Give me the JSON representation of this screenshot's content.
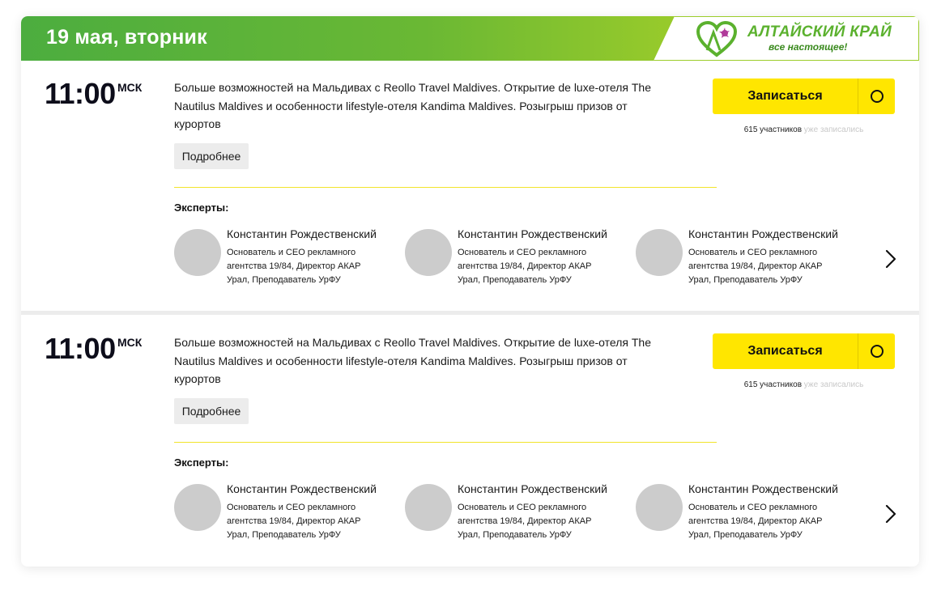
{
  "header": {
    "date_title": "19 мая, вторник",
    "logo": {
      "line1": "АЛТАЙСКИЙ КРАЙ",
      "line2": "все настоящее!",
      "icon": "altai-heart-logo-icon"
    }
  },
  "colors": {
    "header_green": "#4cad3f",
    "header_lime": "#b6d424",
    "signup_yellow": "#ffe600",
    "divider_yellow": "#f2e42a",
    "avatar_gray": "#cccccc"
  },
  "sessions": [
    {
      "time": "11:00",
      "tz": "МСК",
      "description": "Больше возможностей на Мальдивах с Reollo Travel Maldives. Открытие de luxe-отеля The Nautilus Maldives и особенности lifestyle-отеля Kandima Maldives. Розыгрыш призов от курортов",
      "more_label": "Подробнее",
      "signup_label": "Записаться",
      "participants_count": "615 участников",
      "participants_suffix": "уже записались",
      "experts_title": "Эксперты:",
      "experts": [
        {
          "name": "Константин Рождественский",
          "role": "Основатель и CEO рекламного агентства 19/84, Директор АКАР Урал, Преподаватель УрФУ"
        },
        {
          "name": "Константин Рождественский",
          "role": "Основатель и CEO рекламного агентства 19/84, Директор АКАР Урал, Преподаватель УрФУ"
        },
        {
          "name": "Константин Рождественский",
          "role": "Основатель и CEO рекламного агентства 19/84, Директор АКАР Урал, Преподаватель УрФУ"
        }
      ]
    },
    {
      "time": "11:00",
      "tz": "МСК",
      "description": "Больше возможностей на Мальдивах с Reollo Travel Maldives. Открытие de luxe-отеля The Nautilus Maldives и особенности lifestyle-отеля Kandima Maldives. Розыгрыш призов от курортов",
      "more_label": "Подробнее",
      "signup_label": "Записаться",
      "participants_count": "615 участников",
      "participants_suffix": "уже записались",
      "experts_title": "Эксперты:",
      "experts": [
        {
          "name": "Константин Рождественский",
          "role": "Основатель и CEO рекламного агентства 19/84, Директор АКАР Урал, Преподаватель УрФУ"
        },
        {
          "name": "Константин Рождественский",
          "role": "Основатель и CEO рекламного агентства 19/84, Директор АКАР Урал, Преподаватель УрФУ"
        },
        {
          "name": "Константин Рождественский",
          "role": "Основатель и CEO рекламного агентства 19/84, Директор АКАР Урал, Преподаватель УрФУ"
        }
      ]
    }
  ]
}
